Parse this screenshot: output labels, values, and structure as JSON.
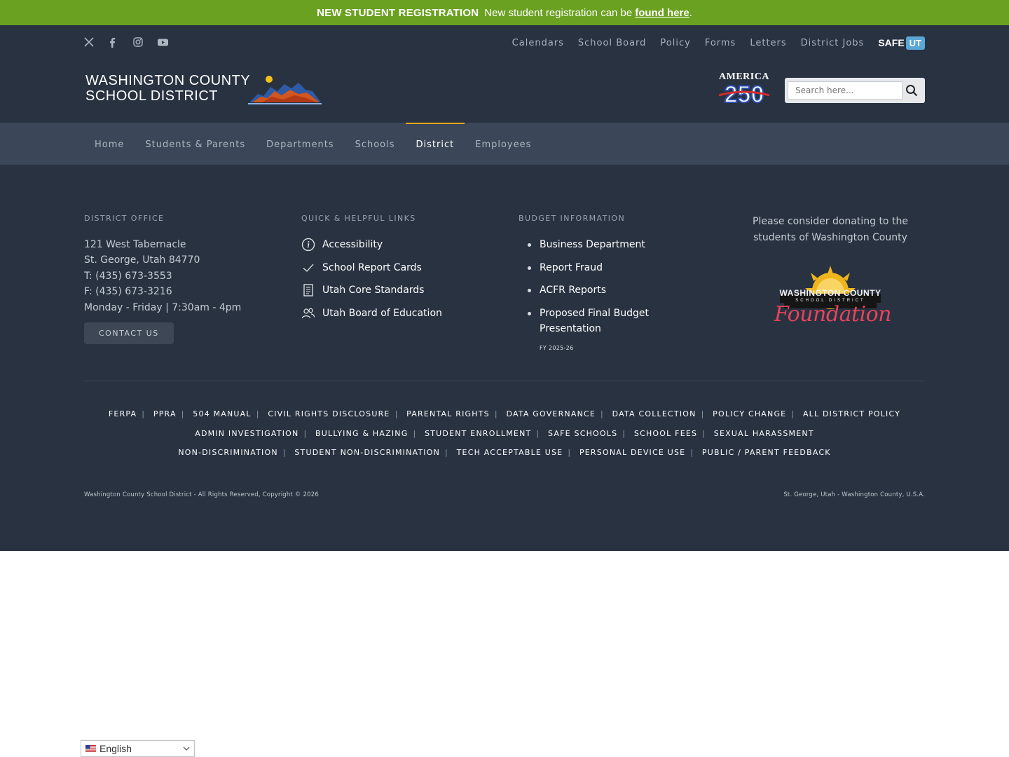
{
  "announcement": {
    "title": "NEW STUDENT REGISTRATION",
    "text": "New student registration can be",
    "link": "found here",
    "period": "."
  },
  "header": {
    "social": [
      "x-icon",
      "facebook-icon",
      "instagram-icon",
      "youtube-icon"
    ],
    "top_links": [
      "Calendars",
      "School Board",
      "Policy",
      "Forms",
      "Letters",
      "District Jobs"
    ],
    "safeut": {
      "safe": "SAFE",
      "ut": "UT"
    },
    "logo_line1": "WASHINGTON COUNTY",
    "logo_line2": "SCHOOL DISTRICT",
    "america_text": "AMERICA",
    "america_num": "250",
    "search_placeholder": "Search here..."
  },
  "nav": {
    "items": [
      "Home",
      "Students & Parents",
      "Departments",
      "Schools",
      "District",
      "Employees"
    ],
    "active": "District"
  },
  "footer": {
    "district_office": {
      "heading": "DISTRICT OFFICE",
      "lines": [
        "121 West Tabernacle",
        "St. George, Utah 84770",
        "T: (435) 673-3553",
        "F: (435) 673-3216",
        "Monday - Friday | 7:30am - 4pm"
      ],
      "button": "CONTACT US"
    },
    "quick_links": {
      "heading": "QUICK & HELPFUL LINKS",
      "items": [
        "Accessibility",
        "School Report Cards",
        "Utah Core Standards",
        "Utah Board of Education"
      ]
    },
    "budget": {
      "heading": "BUDGET INFORMATION",
      "items": [
        "Business Department",
        "Report Fraud",
        "ACFR Reports",
        "Proposed Final Budget Presentation"
      ],
      "fy": "FY 2025-26"
    },
    "donate": {
      "text": "Please consider donating to the students of Washington County",
      "logo_line1": "WASHINGTON COUNTY",
      "logo_line2": "SCHOOL DISTRICT",
      "logo_line3": "Foundation"
    },
    "legal_rows": [
      [
        "FERPA",
        "PPRA",
        "504 MANUAL",
        "CIVIL RIGHTS DISCLOSURE",
        "PARENTAL RIGHTS",
        "DATA GOVERNANCE",
        "DATA COLLECTION",
        "POLICY CHANGE",
        "ALL DISTRICT POLICY"
      ],
      [
        "ADMIN INVESTIGATION",
        "BULLYING & HAZING",
        "STUDENT ENROLLMENT",
        "SAFE SCHOOLS",
        "SCHOOL FEES",
        "SEXUAL HARASSMENT"
      ],
      [
        "NON-DISCRIMINATION",
        "STUDENT NON-DISCRIMINATION",
        "TECH ACCEPTABLE USE",
        "PERSONAL DEVICE USE",
        "PUBLIC / PARENT FEEDBACK"
      ]
    ],
    "copyright": "Washington County School District - All Rights Reserved, Copyright © 2026",
    "location": "St. George, Utah - Washington County, U.S.A."
  },
  "language": {
    "selected": "English"
  }
}
